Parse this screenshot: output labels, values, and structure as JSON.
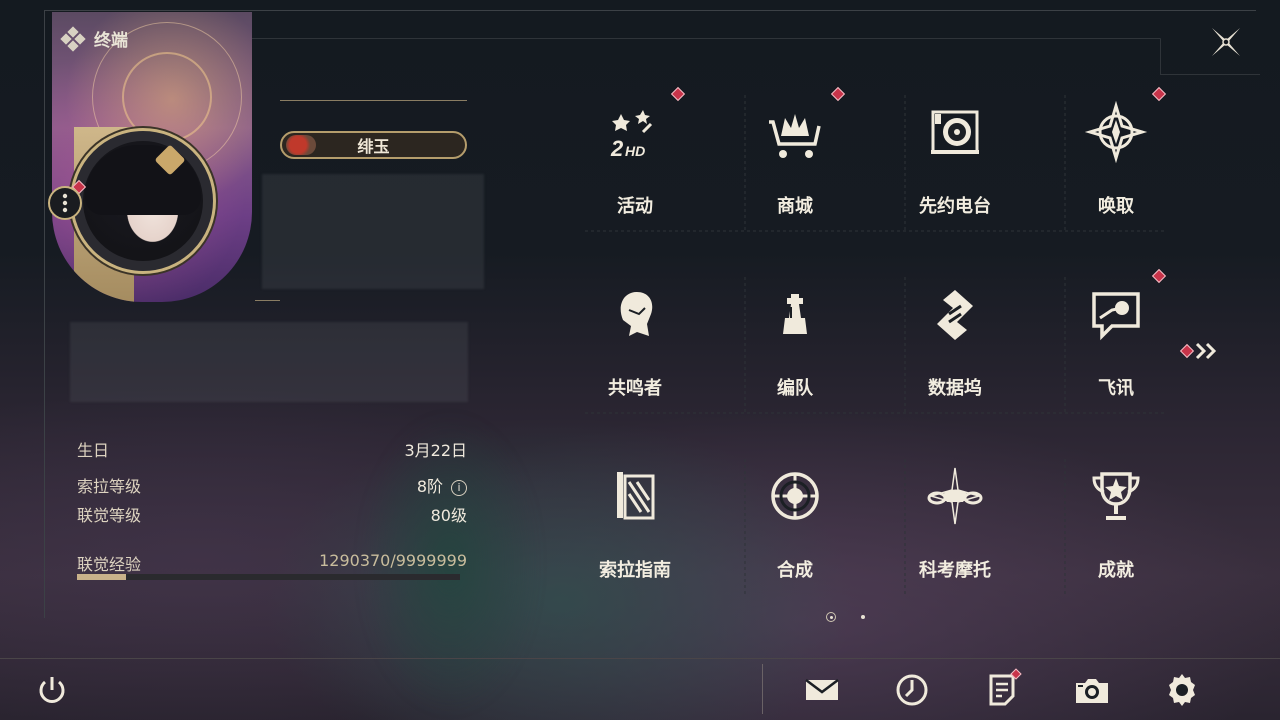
{
  "header": {
    "title": "终端",
    "title_icon": "diamond-cluster-icon",
    "close_icon": "close-x-icon"
  },
  "profile": {
    "name": "绯玉",
    "stats": [
      {
        "label": "生日",
        "value": "3月22日"
      },
      {
        "label": "索拉等级",
        "value": "8阶",
        "info": "i"
      },
      {
        "label": "联觉等级",
        "value": "80级"
      }
    ],
    "experience": {
      "label": "联觉经验",
      "value": "1290370/9999999",
      "progress": 0.129
    }
  },
  "menu": [
    {
      "label": "活动",
      "icon": "event-2hd-icon",
      "badge": true
    },
    {
      "label": "商城",
      "icon": "shop-cart-crown-icon",
      "badge": true
    },
    {
      "label": "先约电台",
      "icon": "radio-record-icon",
      "badge": false
    },
    {
      "label": "唤取",
      "icon": "convene-compass-icon",
      "badge": true
    },
    {
      "label": "共鸣者",
      "icon": "resonator-portrait-icon",
      "badge": false
    },
    {
      "label": "编队",
      "icon": "team-chess-icon",
      "badge": false
    },
    {
      "label": "数据坞",
      "icon": "data-bank-icon",
      "badge": false
    },
    {
      "label": "飞讯",
      "icon": "message-chat-icon",
      "badge": true
    },
    {
      "label": "索拉指南",
      "icon": "guidebook-icon",
      "badge": false
    },
    {
      "label": "合成",
      "icon": "synthesis-orbit-icon",
      "badge": false
    },
    {
      "label": "科考摩托",
      "icon": "motorbike-icon",
      "badge": false
    },
    {
      "label": "成就",
      "icon": "trophy-icon",
      "badge": false
    }
  ],
  "pagination": {
    "current": 1,
    "total": 2,
    "next_icon": "double-chevron-right-icon"
  },
  "bottom_bar": {
    "power_icon": "power-icon",
    "buttons": [
      {
        "icon": "mail-icon",
        "badge": false
      },
      {
        "icon": "clock-history-icon",
        "badge": false
      },
      {
        "icon": "notice-document-icon",
        "badge": true
      },
      {
        "icon": "camera-icon",
        "badge": false
      },
      {
        "icon": "settings-gear-icon",
        "badge": false
      }
    ]
  },
  "colors": {
    "accent_gold": "#c9b37f",
    "badge_red": "#c8344a",
    "text": "#f2ede0"
  }
}
